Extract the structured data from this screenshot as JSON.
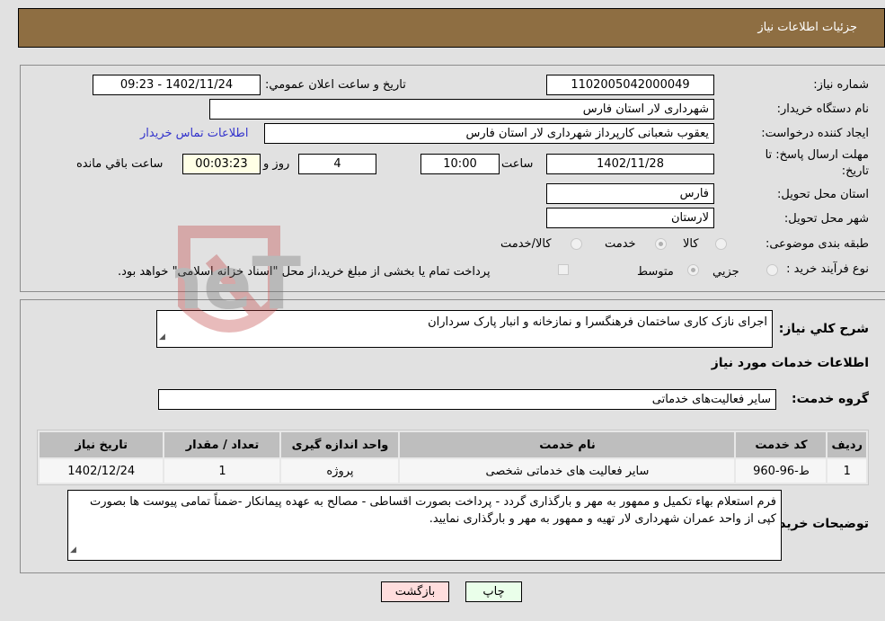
{
  "header": {
    "title": "جزئیات اطلاعات نیاز"
  },
  "form": {
    "need_number": {
      "label": "شماره نیاز:",
      "value": "1102005042000049"
    },
    "announce_datetime": {
      "label": "تاریخ و ساعت اعلان عمومي:",
      "value": "1402/11/24 - 09:23"
    },
    "buyer_org": {
      "label": "نام دستگاه خریدار:",
      "value": "شهرداری لار استان فارس"
    },
    "requester": {
      "label": "ایجاد کننده درخواست:",
      "value": "یعقوب شعبانی کارپرداز شهرداری لار استان فارس"
    },
    "buyer_contact_link": "اطلاعات تماس خریدار",
    "deadline": {
      "label_line1": "مهلت ارسال پاسخ: تا",
      "label_line2": "تاریخ:",
      "date": "1402/11/28",
      "time_label": "ساعت",
      "time": "10:00",
      "days": "4",
      "days_label": "روز و",
      "remaining": "00:03:23",
      "remaining_label": "ساعت باقي مانده"
    },
    "delivery_province": {
      "label": "استان محل تحویل:",
      "value": "فارس"
    },
    "delivery_city": {
      "label": "شهر محل تحویل:",
      "value": "لارستان"
    },
    "category": {
      "label": "طبقه بندی موضوعی:",
      "options": [
        "کالا",
        "خدمت",
        "کالا/خدمت"
      ],
      "selected": "خدمت"
    },
    "purchase_type": {
      "label": "نوع فرآیند خرید :",
      "options": [
        "جزيي",
        "متوسط"
      ],
      "selected": "متوسط",
      "treasury_note": "پرداخت تمام یا بخشی از مبلغ خرید،از محل \"اسناد خزانه اسلامی\" خواهد بود."
    }
  },
  "details": {
    "description": {
      "label": "شرح کلي نیاز:",
      "value": "اجرای نازک کاری ساختمان فرهنگسرا و نمازخانه و انبار پارک سرداران"
    },
    "services_title": "اطلاعات خدمات مورد نیاز",
    "service_group": {
      "label": "گروه خدمت:",
      "value": "سایر فعالیت‌های خدماتی"
    },
    "table": {
      "headers": [
        "ردیف",
        "کد خدمت",
        "نام خدمت",
        "واحد اندازه گیری",
        "تعداد / مقدار",
        "تاریخ نیاز"
      ],
      "rows": [
        [
          "1",
          "ط-96-960",
          "سایر فعالیت های خدماتی شخصی",
          "پروژه",
          "1",
          "1402/12/24"
        ]
      ]
    },
    "buyer_notes": {
      "label": "توضیحات خریدار:",
      "value": "فرم استعلام بهاء تکمیل و ممهور به مهر و بارگذاری گردد - پرداخت بصورت اقساطی - مصالح به عهده پیمانکار -ضمناً تمامی پیوست ها بصورت کپی از واحد عمران شهرداری لار تهیه و ممهور به مهر و بارگذاری نمایید."
    }
  },
  "buttons": {
    "print": "چاپ",
    "back": "بازگشت"
  },
  "colors": {
    "header_bg": "#8e6e42",
    "print_bg": "#eaffea",
    "back_bg": "#ffdddd",
    "link": "#3333cc"
  }
}
